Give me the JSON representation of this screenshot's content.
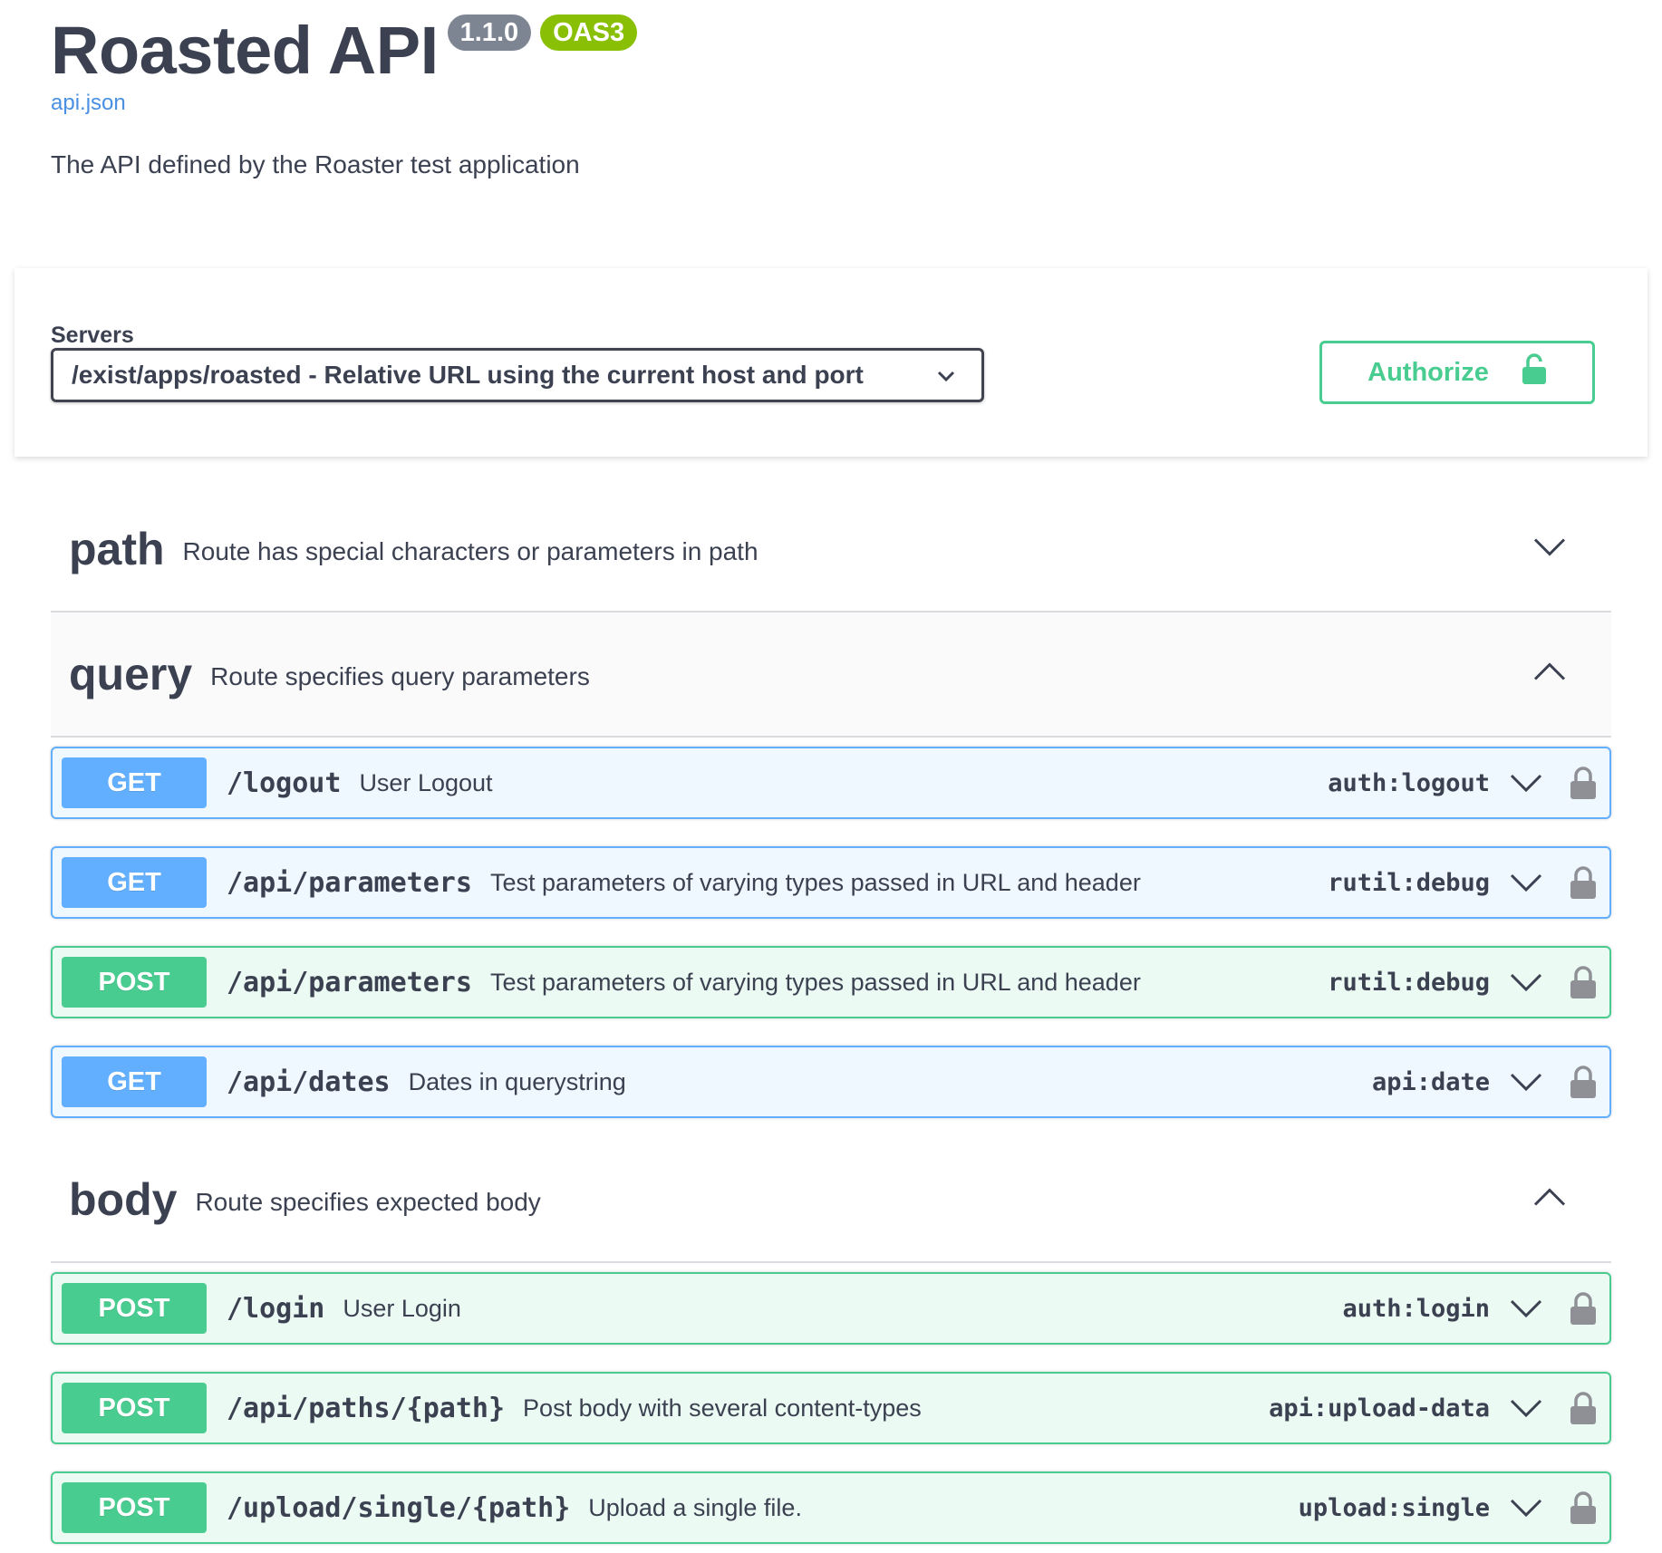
{
  "info": {
    "title": "Roasted API",
    "version": "1.1.0",
    "oas": "OAS3",
    "spec_link": "api.json",
    "description": "The API defined by the Roaster test application"
  },
  "servers": {
    "label": "Servers",
    "selected": "/exist/apps/roasted - Relative URL using the current host and port"
  },
  "authorize": {
    "label": "Authorize"
  },
  "tags": [
    {
      "name": "path",
      "description": "Route has special characters or parameters in path",
      "expanded": false
    },
    {
      "name": "query",
      "description": "Route specifies query parameters",
      "expanded": true,
      "operations": [
        {
          "method": "GET",
          "path": "/logout",
          "summary": "User Logout",
          "operation_id": "auth:logout"
        },
        {
          "method": "GET",
          "path": "/api/parameters",
          "summary": "Test parameters of varying types passed in URL and header",
          "operation_id": "rutil:debug"
        },
        {
          "method": "POST",
          "path": "/api/parameters",
          "summary": "Test parameters of varying types passed in URL and header",
          "operation_id": "rutil:debug"
        },
        {
          "method": "GET",
          "path": "/api/dates",
          "summary": "Dates in querystring",
          "operation_id": "api:date"
        }
      ]
    },
    {
      "name": "body",
      "description": "Route specifies expected body",
      "expanded": true,
      "operations": [
        {
          "method": "POST",
          "path": "/login",
          "summary": "User Login",
          "operation_id": "auth:login"
        },
        {
          "method": "POST",
          "path": "/api/paths/{path}",
          "summary": "Post body with several content-types",
          "operation_id": "api:upload-data"
        },
        {
          "method": "POST",
          "path": "/upload/single/{path}",
          "summary": "Upload a single file.",
          "operation_id": "upload:single"
        }
      ]
    }
  ],
  "colors": {
    "get": "#61affe",
    "post": "#49cc90",
    "authorize": "#49cc90",
    "oas_badge": "#89bf04",
    "version_badge": "#7d8492"
  },
  "icons": {
    "expand": "chevron-down-icon",
    "collapse": "chevron-up-icon",
    "lock": "lock-icon",
    "unlock": "unlock-icon"
  }
}
